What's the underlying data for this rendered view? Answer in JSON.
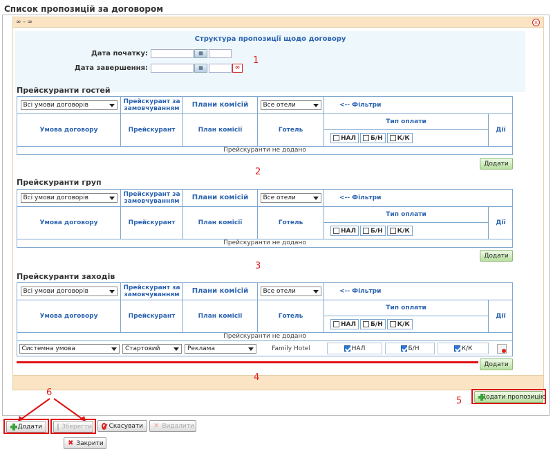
{
  "page_title": "Список пропозицій за договором",
  "panel": {
    "header": "∞ - ∞",
    "close_icon": "close-circle-icon"
  },
  "structure": {
    "title": "Структура пропозиції щодо договору",
    "start_label": "Дата початку:",
    "end_label": "Дата завершення:",
    "cal_glyph": "▦",
    "infinity_glyph": "∞"
  },
  "columns": {
    "conditions_select": "Всі умови договорів",
    "default_pricelist": "Прейскурант за замовчуванням",
    "commission_plans": "Плани комісій",
    "hotel_select": "Все отели",
    "filters": "<-- Фільтри",
    "contract_condition": "Умова договору",
    "pricelist": "Прейскурант",
    "commission_plan": "План комісії",
    "hotel": "Готель",
    "payment_type": "Тип оплати",
    "actions": "Дії",
    "pay_cash": "НАЛ",
    "pay_noncash": "Б/Н",
    "pay_card": "К/К"
  },
  "sections": [
    {
      "title": "Прейскуранти гостей",
      "empty_text": "Прейскуранти не додано",
      "add_label": "Додати"
    },
    {
      "title": "Прейскуранти груп",
      "empty_text": "Прейскуранти не додано",
      "add_label": "Додати"
    },
    {
      "title": "Прейскуранти заходів",
      "empty_text": "Прейскуранти не додано",
      "add_label": "Додати",
      "row": {
        "condition": "Системна умова",
        "pricelist": "Стартовий",
        "plan": "Реклама",
        "hotel": "Family Hotel",
        "cash": true,
        "noncash": true,
        "card": true
      }
    }
  ],
  "annotations": [
    "1",
    "2",
    "3",
    "4",
    "5",
    "6"
  ],
  "add_offer_label": "Додати пропозицію",
  "footer_buttons": {
    "add": "Додати",
    "save": "Зберегти",
    "cancel": "Скасувати",
    "delete": "Видалити",
    "close": "Закрити"
  },
  "colors": {
    "accent": "#2b63b0",
    "panel_bg": "#fbe4c4",
    "highlight": "#e01010"
  }
}
